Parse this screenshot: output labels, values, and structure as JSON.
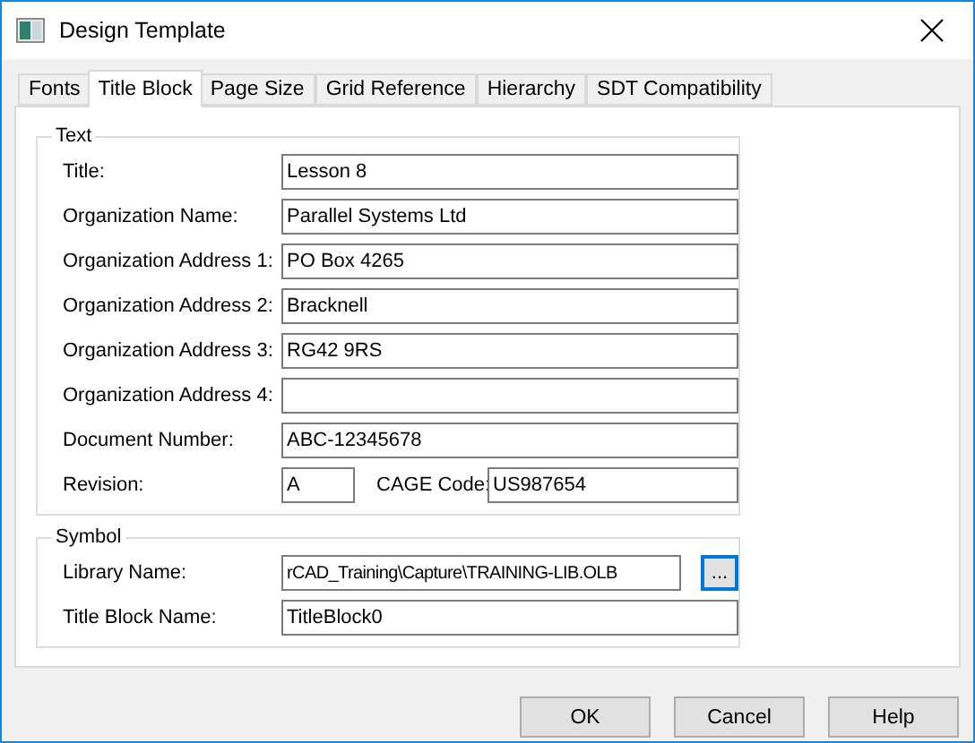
{
  "window": {
    "title": "Design Template"
  },
  "tabs": [
    {
      "label": "Fonts",
      "selected": false
    },
    {
      "label": "Title Block",
      "selected": true
    },
    {
      "label": "Page Size",
      "selected": false
    },
    {
      "label": "Grid Reference",
      "selected": false
    },
    {
      "label": "Hierarchy",
      "selected": false
    },
    {
      "label": "SDT Compatibility",
      "selected": false
    }
  ],
  "text_group": {
    "title": "Text",
    "fields": [
      {
        "label": "Title:",
        "value": "Lesson 8"
      },
      {
        "label": "Organization Name:",
        "value": "Parallel Systems Ltd"
      },
      {
        "label": "Organization Address 1:",
        "value": "PO Box 4265"
      },
      {
        "label": "Organization Address 2:",
        "value": "Bracknell"
      },
      {
        "label": "Organization Address 3:",
        "value": "RG42 9RS"
      },
      {
        "label": "Organization Address 4:"
      },
      {
        "label": "Document Number:",
        "value": "ABC-12345678"
      }
    ],
    "revision": {
      "label": "Revision:",
      "value": "A"
    },
    "cage_code": {
      "label": "CAGE Code:",
      "value": "US987654"
    }
  },
  "symbol_group": {
    "title": "Symbol",
    "library": {
      "label": "Library Name:",
      "value": "rCAD_Training\\Capture\\TRAINING-LIB.OLB",
      "browse": "...",
      "browse_focused": true
    },
    "title_block": {
      "label": "Title Block Name:",
      "value": "TitleBlock0"
    }
  },
  "buttons": [
    "OK",
    "Cancel",
    "Help"
  ]
}
